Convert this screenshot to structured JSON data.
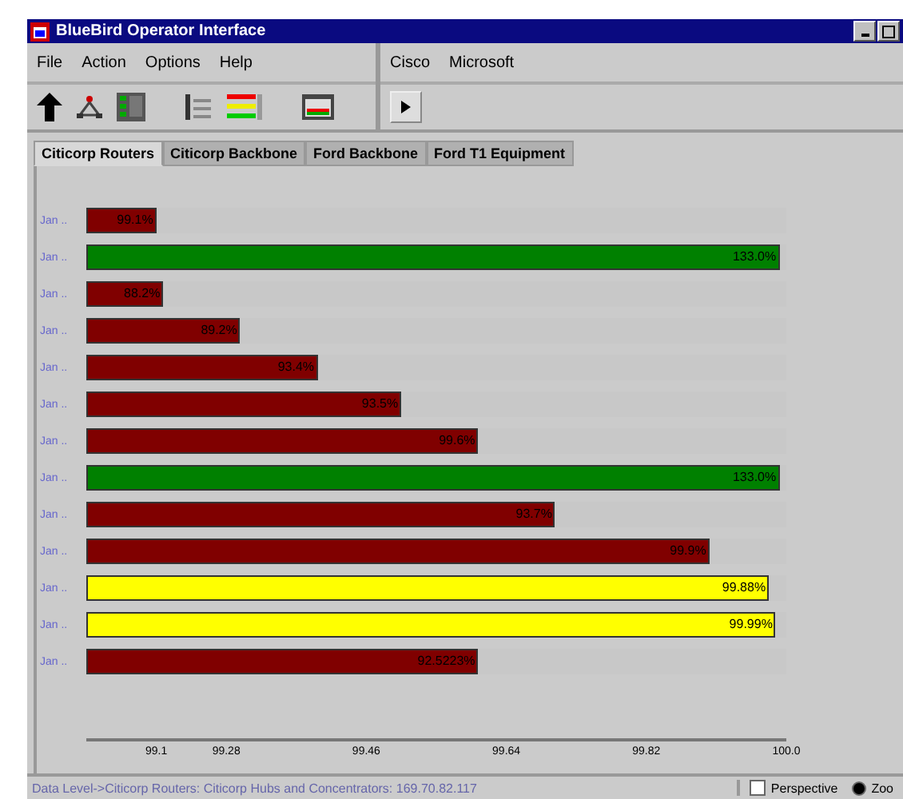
{
  "window": {
    "title": "BlueBird Operator Interface"
  },
  "menus_left": [
    {
      "label": "File"
    },
    {
      "label": "Action"
    },
    {
      "label": "Options"
    },
    {
      "label": "Help"
    }
  ],
  "menus_right": [
    {
      "label": "Cisco"
    },
    {
      "label": "Microsoft"
    }
  ],
  "tabs": [
    {
      "label": "Citicorp Routers",
      "selected": true
    },
    {
      "label": "Citicorp Backbone",
      "selected": false
    },
    {
      "label": "Ford Backbone",
      "selected": false
    },
    {
      "label": "Ford T1 Equipment",
      "selected": false
    }
  ],
  "bars": [
    {
      "label": "Jan ..",
      "level": 0.1,
      "reading": "99.1%",
      "color": "#800000"
    },
    {
      "label": "Jan ..",
      "level": 0.99,
      "reading": "133.0%",
      "color": "#008000"
    },
    {
      "label": "Jan ..",
      "level": 0.11,
      "reading": "88.2%",
      "color": "#800000"
    },
    {
      "label": "Jan ..",
      "level": 0.22,
      "reading": "89.2%",
      "color": "#800000"
    },
    {
      "label": "Jan ..",
      "level": 0.33,
      "reading": "93.4%",
      "color": "#800000"
    },
    {
      "label": "Jan ..",
      "level": 0.45,
      "reading": "93.5%",
      "color": "#800000"
    },
    {
      "label": "Jan ..",
      "level": 0.56,
      "reading": "99.6%",
      "color": "#800000"
    },
    {
      "label": "Jan ..",
      "level": 0.99,
      "reading": "133.0%",
      "color": "#008000"
    },
    {
      "label": "Jan ..",
      "level": 0.67,
      "reading": "93.7%",
      "color": "#800000"
    },
    {
      "label": "Jan ..",
      "level": 0.89,
      "reading": "99.9%",
      "color": "#800000"
    },
    {
      "label": "Jan ..",
      "level": 0.975,
      "reading": "99.88%",
      "color": "#ffff00"
    },
    {
      "label": "Jan ..",
      "level": 0.985,
      "reading": "99.99%",
      "color": "#ffff00"
    },
    {
      "label": "Jan ..",
      "level": 0.56,
      "reading": "92.5223%",
      "color": "#800000"
    }
  ],
  "axis_ticks": [
    "99.1",
    "99.28",
    "99.46",
    "99.64",
    "99.82",
    "100.0"
  ],
  "status_bar": {
    "text": "Data Level->Citicorp Routers: Citicorp Hubs and Concentrators: 169.70.82.117",
    "perspective": {
      "label": "Perspective",
      "checked": false
    },
    "zoom": {
      "label": "Zoo",
      "selected": true
    }
  }
}
